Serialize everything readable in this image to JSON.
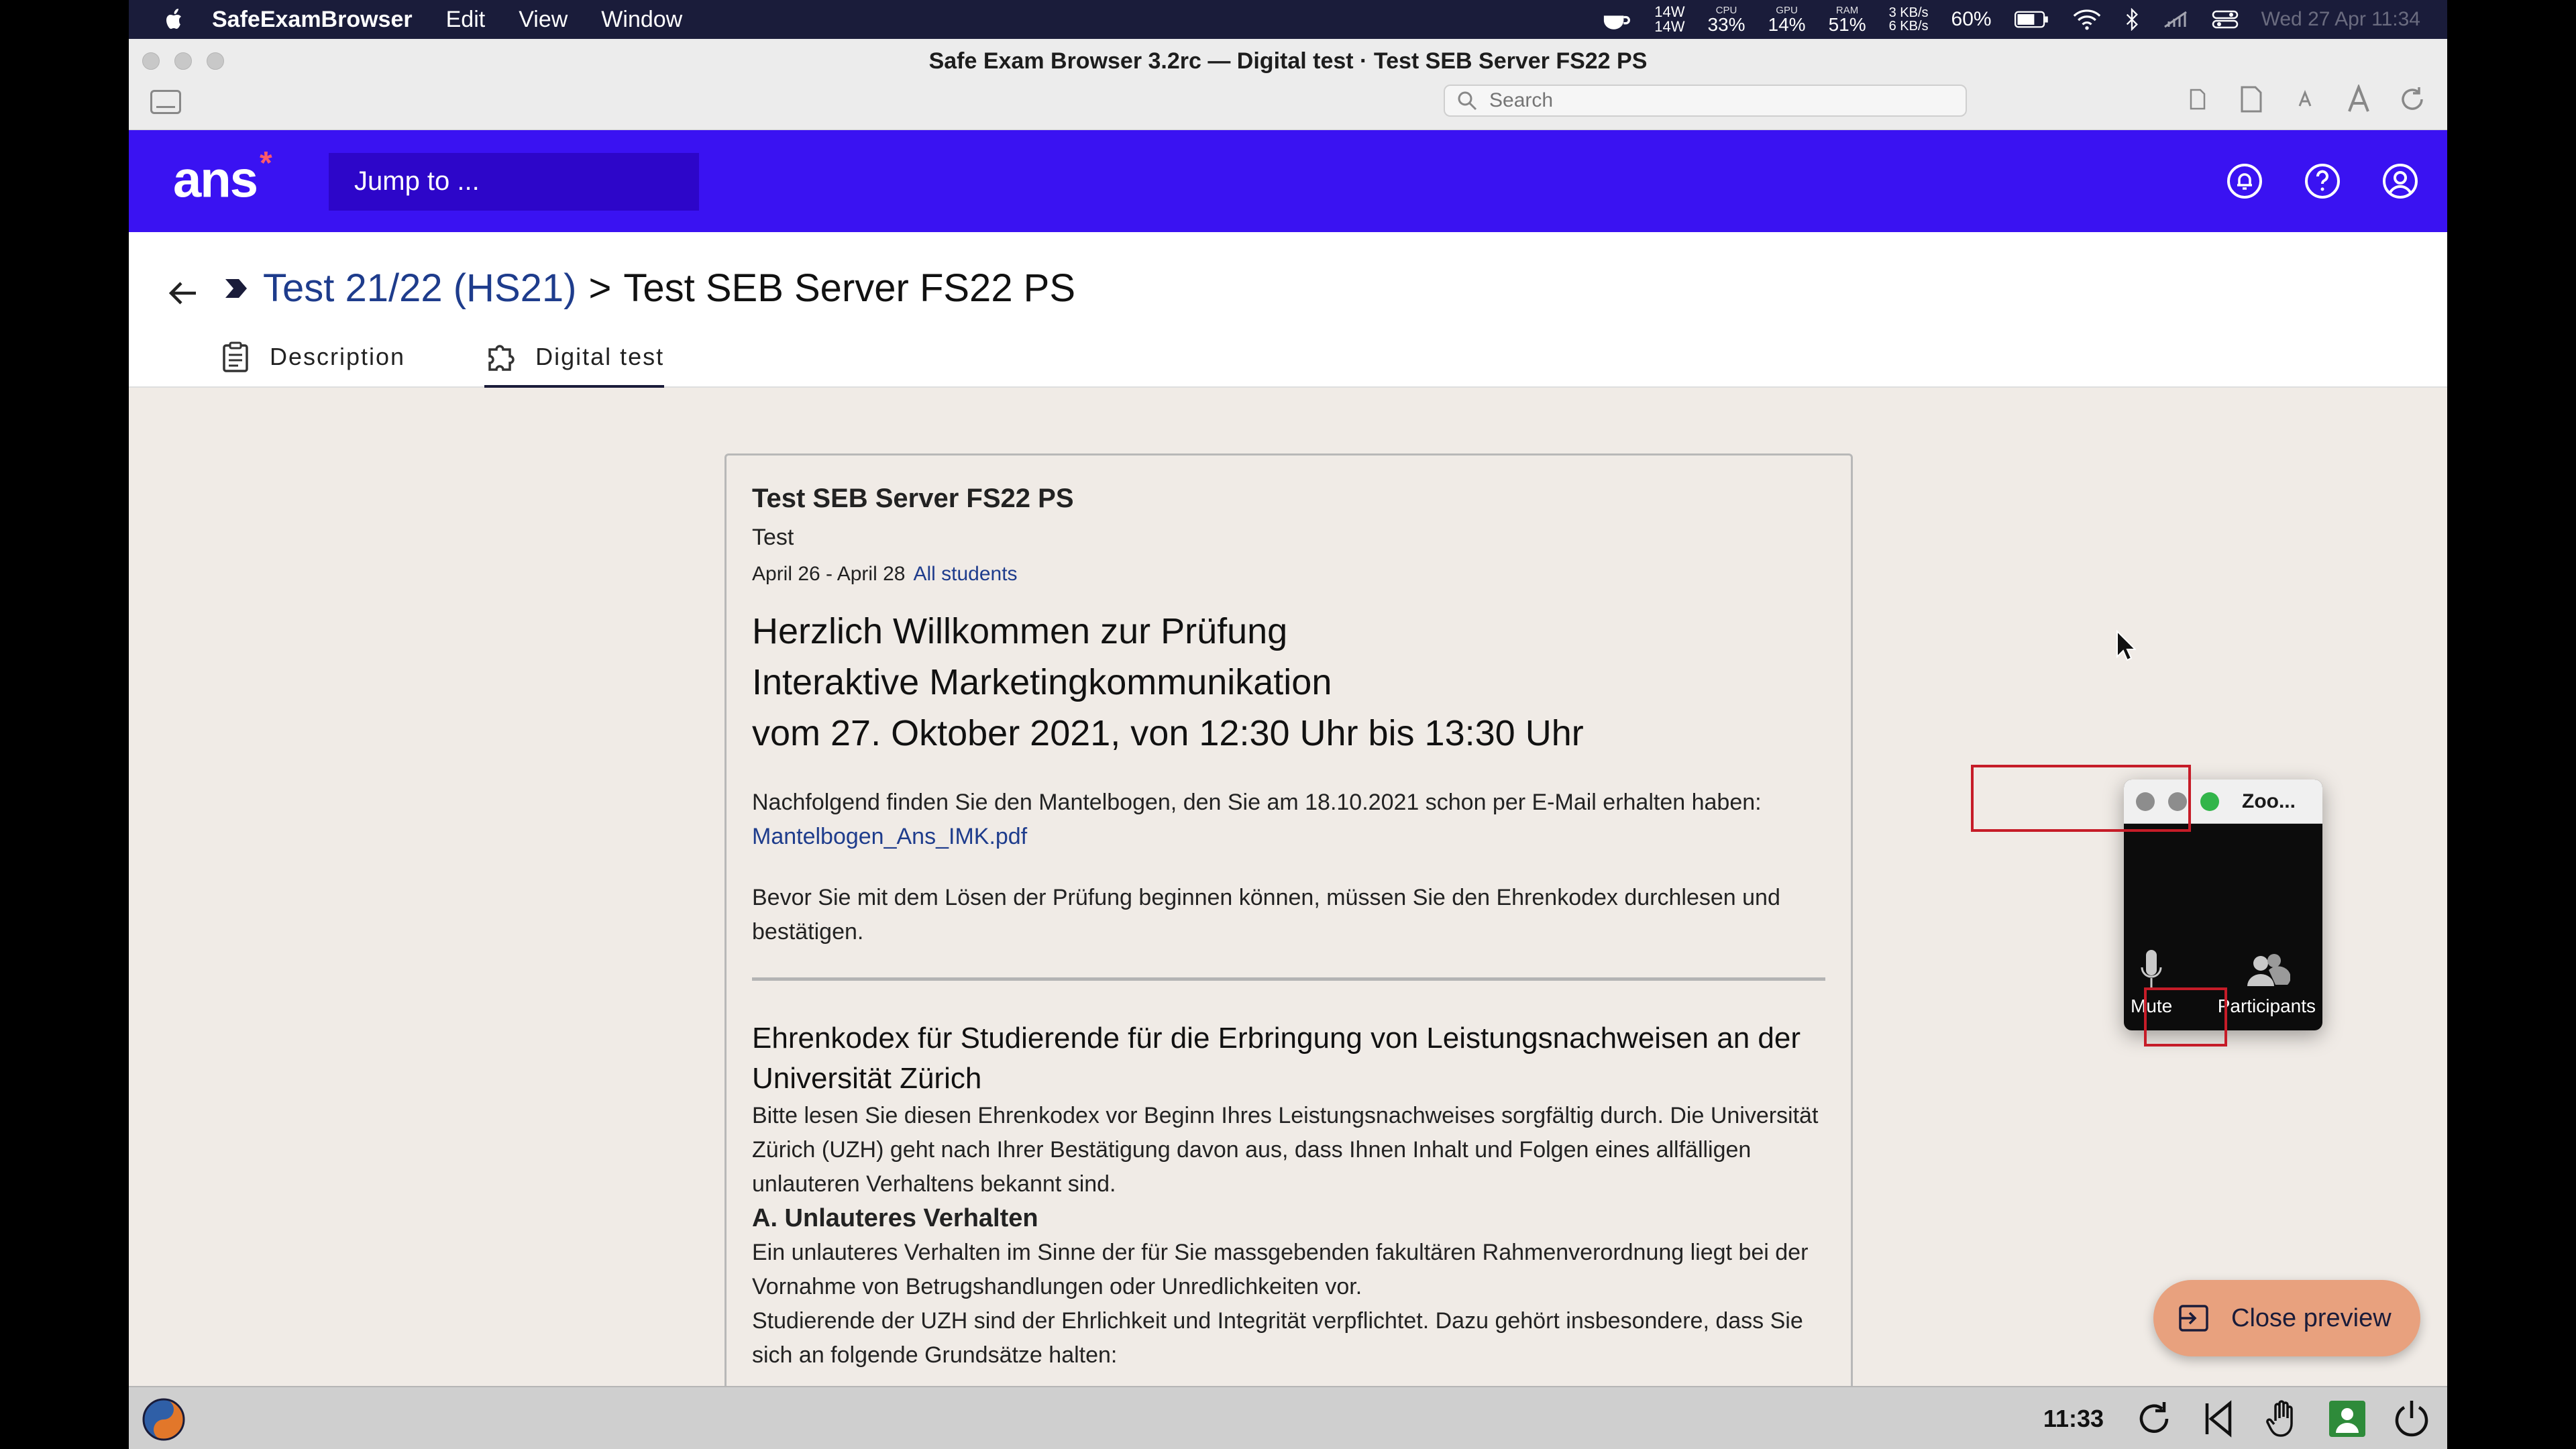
{
  "menubar": {
    "app_name": "SafeExamBrowser",
    "items": [
      "Edit",
      "View",
      "Window"
    ],
    "power": {
      "top": "14W",
      "bottom": "14W"
    },
    "cpu": {
      "label": "CPU",
      "value": "33%"
    },
    "gpu": {
      "label": "GPU",
      "value": "14%"
    },
    "ram": {
      "label": "RAM",
      "value": "51%"
    },
    "net": {
      "up": "3 KB/s",
      "down": "6 KB/s"
    },
    "battery": "60%",
    "datetime": "Wed 27 Apr  11:34"
  },
  "window": {
    "title": "Safe Exam Browser 3.2rc  —  Digital test · Test SEB Server FS22 PS",
    "search_placeholder": "Search"
  },
  "app": {
    "logo": "ans",
    "logo_mark": "*",
    "jump_label": "Jump to ..."
  },
  "breadcrumb": {
    "parent": "Test 21/22 (HS21)",
    "separator": ">",
    "current": "Test SEB Server FS22 PS"
  },
  "tabs": [
    {
      "label": "Description",
      "icon": "clipboard-icon"
    },
    {
      "label": "Digital test",
      "icon": "puzzle-icon"
    }
  ],
  "card": {
    "title": "Test SEB Server FS22 PS",
    "subtitle": "Test",
    "dates": "April 26 - April 28",
    "audience": "All students",
    "heading_lines": [
      "Herzlich Willkommen zur Prüfung",
      "Interaktive Marketingkommunikation",
      "vom 27. Oktober 2021, von 12:30 Uhr bis 13:30 Uhr"
    ],
    "intro": "Nachfolgend finden Sie den Mantelbogen, den Sie am 18.10.2021 schon per E-Mail erhalten haben:",
    "attachment": "Mantelbogen_Ans_IMK.pdf",
    "notice": "Bevor Sie mit dem Lösen der Prüfung beginnen können, müssen Sie den Ehrenkodex durchlesen und bestätigen.",
    "code_heading": "Ehrenkodex für Studierende für die Erbringung von Leistungsnachweisen an der Universität Zürich",
    "code_intro": "Bitte lesen Sie diesen Ehrenkodex vor Beginn Ihres Leistungsnachweises sorgfältig durch. Die Universität Zürich (UZH) geht nach Ihrer Bestätigung davon aus, dass Ihnen Inhalt und Folgen eines allfälligen unlauteren Verhaltens bekannt sind.",
    "section_a": "A. Unlauteres Verhalten",
    "section_a_text": "Ein unlauteres Verhalten im Sinne der für Sie massgebenden fakultären Rahmenverordnung liegt bei der Vornahme von Betrugshandlungen oder Unredlichkeiten vor.",
    "section_a_text2": "Studierende der UZH sind der Ehrlichkeit und Integrität verpflichtet. Dazu gehört insbesondere, dass Sie sich an folgende Grundsätze halten:"
  },
  "zoom": {
    "title": "Zoo...",
    "mute_label": "Mute",
    "participants_label": "Participants"
  },
  "close_preview": "Close preview",
  "taskbar": {
    "time": "11:33"
  },
  "colors": {
    "brand": "#3a12f2",
    "brand_dark": "#2d06c9",
    "link": "#1e3c8c",
    "accent_button": "#e8a17e",
    "highlight_box": "#c61c28"
  }
}
